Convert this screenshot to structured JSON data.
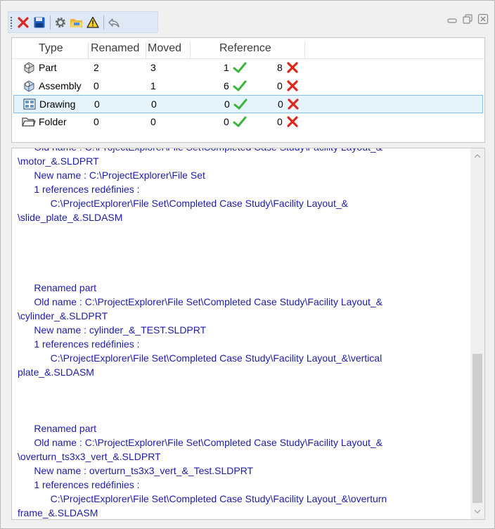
{
  "toolbar": {
    "icons": [
      "close-icon",
      "save-icon",
      "settings-icon",
      "folder-icon",
      "warning-icon",
      "undo-icon"
    ]
  },
  "colors": {
    "ok": "#3ab53a",
    "error": "#e0251b",
    "log_text": "#1c1ca8",
    "selected_row": "#e5f3fb"
  },
  "grid": {
    "headers": {
      "type": "Type",
      "renamed": "Renamed",
      "moved": "Moved",
      "reference": "Reference"
    },
    "rows": [
      {
        "icon": "part-icon",
        "type": "Part",
        "renamed": "2",
        "moved": "3",
        "ref_ok": "1",
        "ref_fail": "8"
      },
      {
        "icon": "assembly-icon",
        "type": "Assembly",
        "renamed": "0",
        "moved": "1",
        "ref_ok": "6",
        "ref_fail": "0"
      },
      {
        "icon": "drawing-icon",
        "type": "Drawing",
        "renamed": "0",
        "moved": "0",
        "ref_ok": "0",
        "ref_fail": "0"
      },
      {
        "icon": "folder-icon",
        "type": "Folder",
        "renamed": "0",
        "moved": "0",
        "ref_ok": "0",
        "ref_fail": "0"
      }
    ]
  },
  "log": {
    "lines": [
      "      Old name : C:\\ProjectExplorer\\File Set\\Completed Case Study\\Facility Layout_&",
      "\\motor_&.SLDPRT",
      "      New name : C:\\ProjectExplorer\\File Set",
      "      1 references redéfinies :",
      "            C:\\ProjectExplorer\\File Set\\Completed Case Study\\Facility Layout_&",
      "\\slide_plate_&.SLDASM",
      "",
      "",
      "",
      "",
      "      Renamed part",
      "      Old name : C:\\ProjectExplorer\\File Set\\Completed Case Study\\Facility Layout_&",
      "\\cylinder_&.SLDPRT",
      "      New name : cylinder_&_TEST.SLDPRT",
      "      1 references redéfinies :",
      "            C:\\ProjectExplorer\\File Set\\Completed Case Study\\Facility Layout_&\\vertical",
      "plate_&.SLDASM",
      "",
      "",
      "",
      "      Renamed part",
      "      Old name : C:\\ProjectExplorer\\File Set\\Completed Case Study\\Facility Layout_&",
      "\\overturn_ts3x3_vert_&.SLDPRT",
      "      New name : overturn_ts3x3_vert_&_Test.SLDPRT",
      "      1 references redéfinies :",
      "            C:\\ProjectExplorer\\File Set\\Completed Case Study\\Facility Layout_&\\overturn",
      "frame_&.SLDASM"
    ]
  }
}
